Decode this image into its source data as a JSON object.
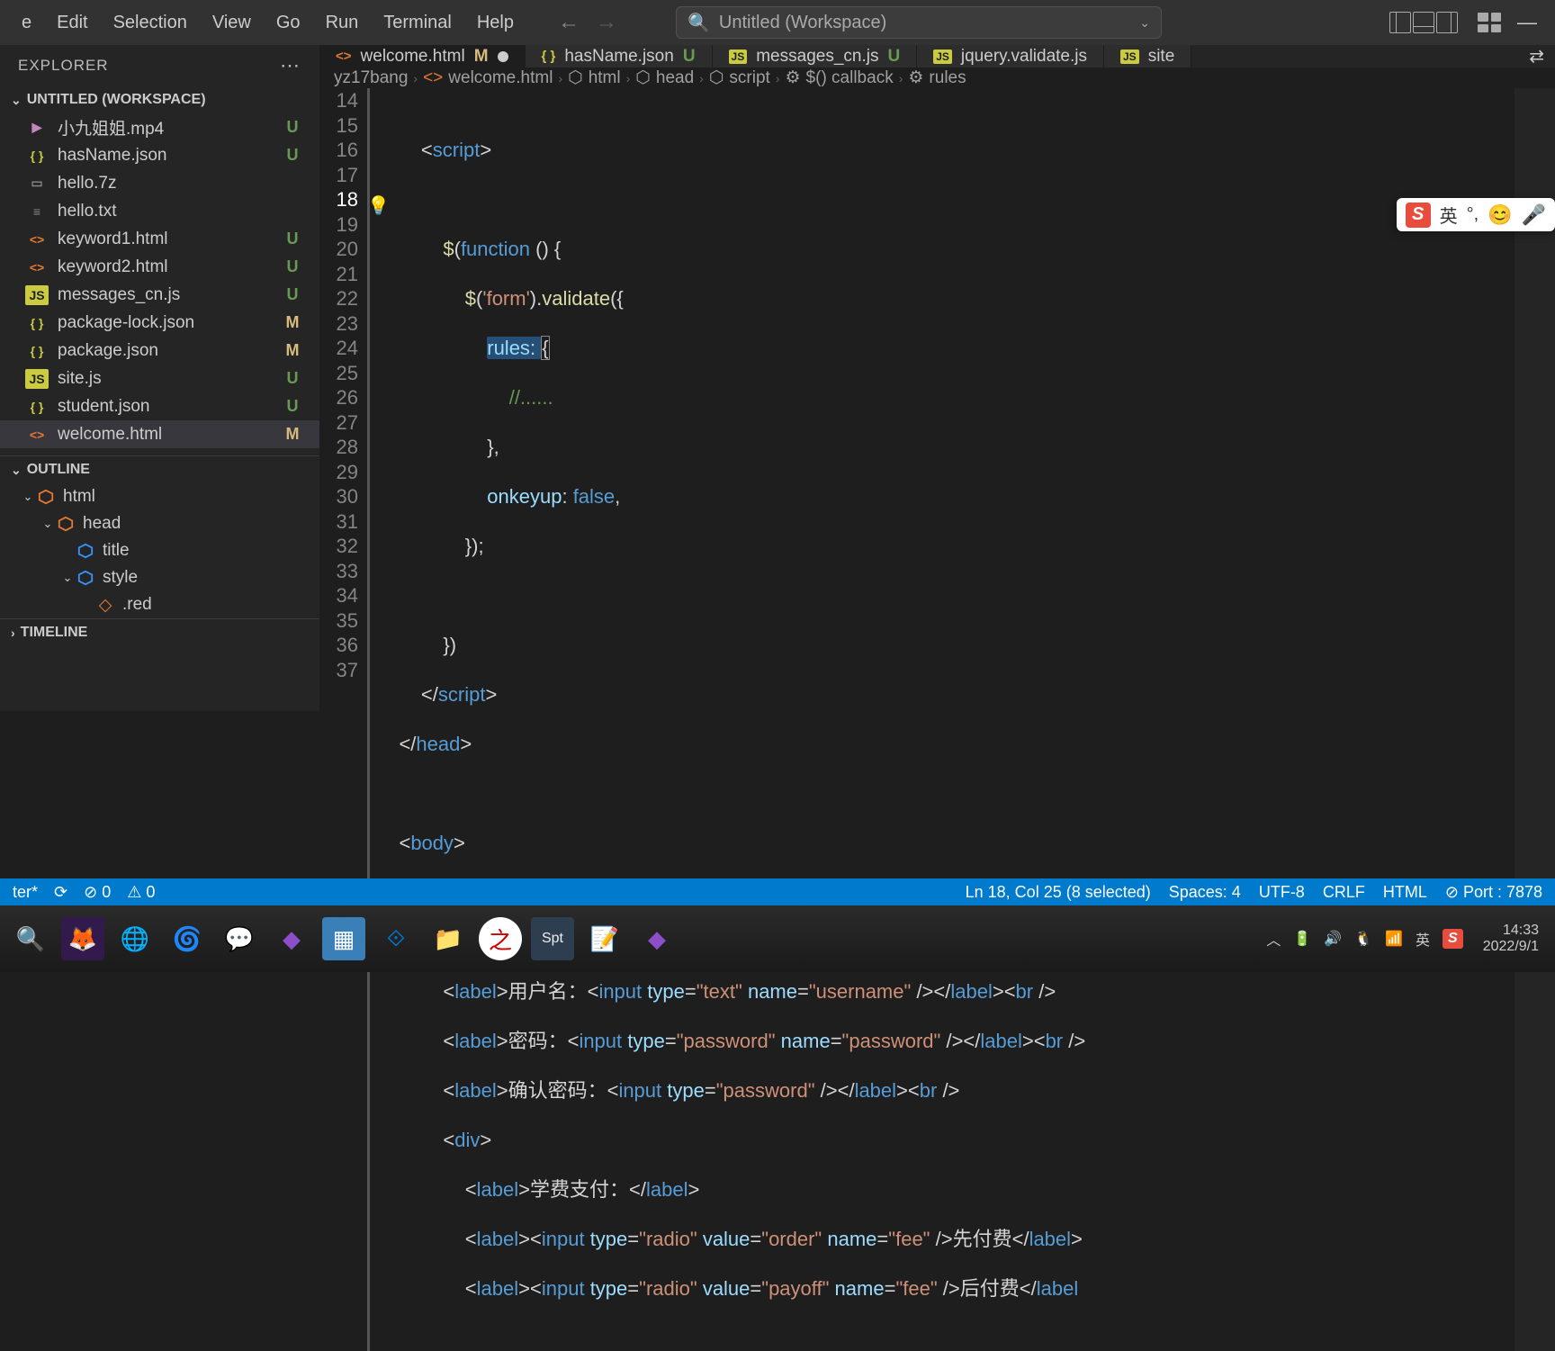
{
  "menu": [
    "e",
    "Edit",
    "Selection",
    "View",
    "Go",
    "Run",
    "Terminal",
    "Help"
  ],
  "searchPlaceholder": "Untitled (Workspace)",
  "explorer": {
    "title": "EXPLORER",
    "workspace": "UNTITLED (WORKSPACE)"
  },
  "files": [
    {
      "icon": "mp4",
      "name": "小九姐姐.mp4",
      "status": "U",
      "iconText": "▶"
    },
    {
      "icon": "json",
      "name": "hasName.json",
      "status": "U",
      "iconText": "{ }"
    },
    {
      "icon": "7z",
      "name": "hello.7z",
      "status": "",
      "iconText": "▭"
    },
    {
      "icon": "txt",
      "name": "hello.txt",
      "status": "",
      "iconText": "≡"
    },
    {
      "icon": "html",
      "name": "keyword1.html",
      "status": "U",
      "iconText": "<>"
    },
    {
      "icon": "html",
      "name": "keyword2.html",
      "status": "U",
      "iconText": "<>"
    },
    {
      "icon": "js",
      "name": "messages_cn.js",
      "status": "U",
      "iconText": "JS"
    },
    {
      "icon": "json",
      "name": "package-lock.json",
      "status": "M",
      "iconText": "{ }"
    },
    {
      "icon": "json",
      "name": "package.json",
      "status": "M",
      "iconText": "{ }"
    },
    {
      "icon": "js",
      "name": "site.js",
      "status": "U",
      "iconText": "JS"
    },
    {
      "icon": "json",
      "name": "student.json",
      "status": "U",
      "iconText": "{ }"
    },
    {
      "icon": "html",
      "name": "welcome.html",
      "status": "M",
      "iconText": "<>",
      "active": true
    }
  ],
  "outline": {
    "title": "OUTLINE",
    "items": [
      {
        "indent": 1,
        "chev": "v",
        "name": "html"
      },
      {
        "indent": 2,
        "chev": "v",
        "name": "head"
      },
      {
        "indent": 3,
        "chev": "",
        "name": "title"
      },
      {
        "indent": 3,
        "chev": "v",
        "name": "style"
      },
      {
        "indent": 4,
        "chev": "",
        "name": ".red"
      }
    ]
  },
  "timeline": "TIMELINE",
  "tabs": [
    {
      "icon": "html",
      "iconText": "<>",
      "name": "welcome.html",
      "status": "M",
      "dirty": true,
      "active": true,
      "statusClass": "st-M"
    },
    {
      "icon": "json",
      "iconText": "{ }",
      "name": "hasName.json",
      "status": "U",
      "statusClass": "st-U"
    },
    {
      "icon": "js",
      "iconText": "JS",
      "name": "messages_cn.js",
      "status": "U",
      "statusClass": "st-U"
    },
    {
      "icon": "js",
      "iconText": "JS",
      "name": "jquery.validate.js",
      "status": ""
    },
    {
      "icon": "js",
      "iconText": "JS",
      "name": "site",
      "status": ""
    }
  ],
  "breadcrumb": [
    "yz17bang",
    "welcome.html",
    "html",
    "head",
    "script",
    "$() callback",
    "rules"
  ],
  "lineStart": 14,
  "lineEnd": 37,
  "currentLine": 18,
  "ime": {
    "lang": "英"
  },
  "status": {
    "left": [
      "ter*",
      "⊘ 0",
      "⚠ 0"
    ],
    "cursor": "Ln 18, Col 25 (8 selected)",
    "spaces": "Spaces: 4",
    "encoding": "UTF-8",
    "eol": "CRLF",
    "lang": "HTML",
    "port": "Port : 7878"
  },
  "clock": {
    "time": "14:33",
    "date": "2022/9/1"
  }
}
